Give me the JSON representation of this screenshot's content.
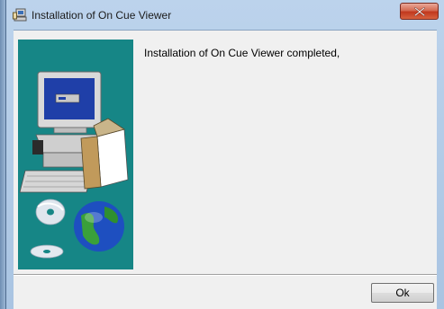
{
  "window": {
    "title": "Installation of On Cue Viewer",
    "title_icon": "installer-icon",
    "close_icon": "close-icon"
  },
  "content": {
    "message": "Installation of On Cue Viewer completed,",
    "illustration": "computer-install-illustration"
  },
  "buttons": {
    "ok_label": "Ok"
  },
  "colors": {
    "illustration_background": "#168686",
    "close_button": "#c1371d",
    "title_bar": "#bcd3ec",
    "dialog_background": "#f0f0f0"
  }
}
